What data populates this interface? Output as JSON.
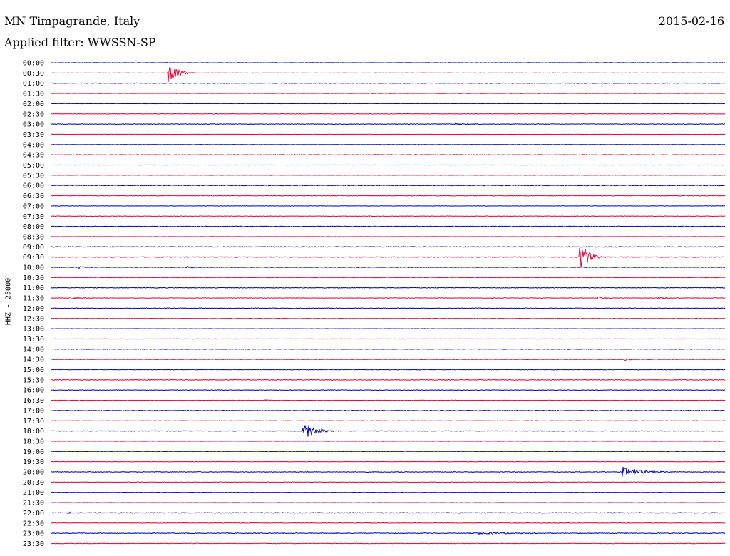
{
  "header": {
    "title": "MN Timpagrande, Italy",
    "date": "2015-02-16",
    "filter": "Applied filter: WWSSN-SP"
  },
  "channel_label": "HHZ - 25000",
  "colors": {
    "blue": "#0000cc",
    "red": "#ee0033",
    "background": "#ffffff",
    "text": "#000000"
  },
  "chart_data": {
    "type": "line",
    "description_units": "row = 30-minute trace; x = minutes within row (0-30); amplitude = relative deflection",
    "row_labels": [
      "00:00",
      "00:30",
      "01:00",
      "01:30",
      "02:00",
      "02:30",
      "03:00",
      "03:30",
      "04:00",
      "04:30",
      "05:00",
      "05:30",
      "06:00",
      "06:30",
      "07:00",
      "07:30",
      "08:00",
      "08:30",
      "09:00",
      "09:30",
      "10:00",
      "10:30",
      "11:00",
      "11:30",
      "12:00",
      "12:30",
      "13:00",
      "13:30",
      "14:00",
      "14:30",
      "15:00",
      "15:30",
      "16:00",
      "16:30",
      "17:00",
      "17:30",
      "18:00",
      "18:30",
      "19:00",
      "19:30",
      "20:00",
      "20:30",
      "21:00",
      "21:30",
      "22:00",
      "22:30",
      "23:00",
      "23:30"
    ],
    "row_colors": [
      "blue",
      "red"
    ],
    "noise_levels": [
      0.6,
      0.5,
      0.8,
      0.6,
      0.4,
      0.6,
      0.7,
      0.4,
      0.4,
      0.9,
      0.3,
      0.5,
      1.0,
      0.9,
      0.4,
      0.7,
      0.9,
      0.4,
      1.0,
      1.1,
      0.7,
      0.7,
      0.9,
      0.6,
      0.8,
      0.6,
      0.4,
      0.5,
      0.7,
      0.6,
      0.8,
      0.9,
      0.7,
      0.6,
      0.8,
      0.6,
      0.8,
      0.6,
      0.5,
      0.5,
      0.9,
      0.7,
      0.4,
      0.5,
      1.0,
      0.6,
      0.9,
      0.8
    ],
    "events": [
      {
        "row": 1,
        "t": 5.15,
        "amp": 16,
        "dur": 1.1
      },
      {
        "row": 6,
        "t": 18.0,
        "amp": 2.5,
        "dur": 1.4
      },
      {
        "row": 19,
        "t": 23.5,
        "amp": 28,
        "dur": 0.9
      },
      {
        "row": 20,
        "t": 1.2,
        "amp": 2,
        "dur": 0.8
      },
      {
        "row": 20,
        "t": 6.0,
        "amp": 2,
        "dur": 1.0
      },
      {
        "row": 23,
        "t": 0.8,
        "amp": 2,
        "dur": 1.4
      },
      {
        "row": 23,
        "t": 24.3,
        "amp": 2,
        "dur": 1.2
      },
      {
        "row": 23,
        "t": 27.0,
        "amp": 2,
        "dur": 1.0
      },
      {
        "row": 29,
        "t": 25.5,
        "amp": 1.5,
        "dur": 1.0
      },
      {
        "row": 33,
        "t": 9.5,
        "amp": 1.5,
        "dur": 0.6
      },
      {
        "row": 36,
        "t": 11.2,
        "amp": 16,
        "dur": 1.2
      },
      {
        "row": 40,
        "t": 25.4,
        "amp": 8,
        "dur": 2.0
      },
      {
        "row": 44,
        "t": 0.7,
        "amp": 4,
        "dur": 0.3
      },
      {
        "row": 46,
        "t": 19.0,
        "amp": 1.5,
        "dur": 5.0
      }
    ],
    "xlim": [
      0,
      30
    ],
    "grid": false,
    "legend": "none"
  }
}
